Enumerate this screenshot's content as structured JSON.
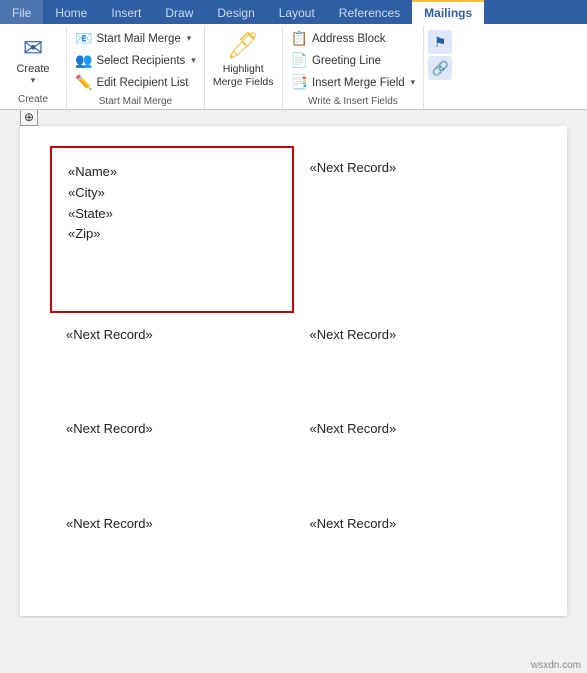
{
  "ribbon": {
    "tabs": [
      "File",
      "Home",
      "Insert",
      "Draw",
      "Design",
      "Layout",
      "References",
      "Mailings"
    ],
    "active_tab": "Mailings",
    "groups": {
      "create": {
        "label": "Create",
        "caret": "▾"
      },
      "start_mail_merge": {
        "label": "Start Mail Merge",
        "buttons": [
          {
            "label": "Start Mail Merge",
            "caret": "▾"
          },
          {
            "label": "Select Recipients",
            "caret": "▾"
          },
          {
            "label": "Edit Recipient List"
          }
        ]
      },
      "highlight": {
        "label": "Highlight\nMerge Fields"
      },
      "write_insert": {
        "label": "Write & Insert Fields",
        "buttons": [
          {
            "label": "Address Block"
          },
          {
            "label": "Greeting Line"
          },
          {
            "label": "Insert Merge Field",
            "caret": "▾"
          }
        ]
      }
    }
  },
  "document": {
    "move_handle": "⊕",
    "cells": [
      {
        "type": "fields",
        "fields": [
          "«Name»",
          "«City»",
          "«State»",
          "«Zip»"
        ],
        "highlighted": true
      },
      {
        "type": "next_record",
        "text": "«Next Record»"
      },
      {
        "type": "next_record",
        "text": "«Next Record»"
      },
      {
        "type": "next_record",
        "text": "«Next Record»"
      },
      {
        "type": "next_record",
        "text": "«Next Record»"
      },
      {
        "type": "next_record",
        "text": "«Next Record»"
      },
      {
        "type": "next_record",
        "text": "«Next Record»"
      },
      {
        "type": "next_record",
        "text": "«Next Record»"
      }
    ]
  },
  "watermark": "wsxdn.com"
}
